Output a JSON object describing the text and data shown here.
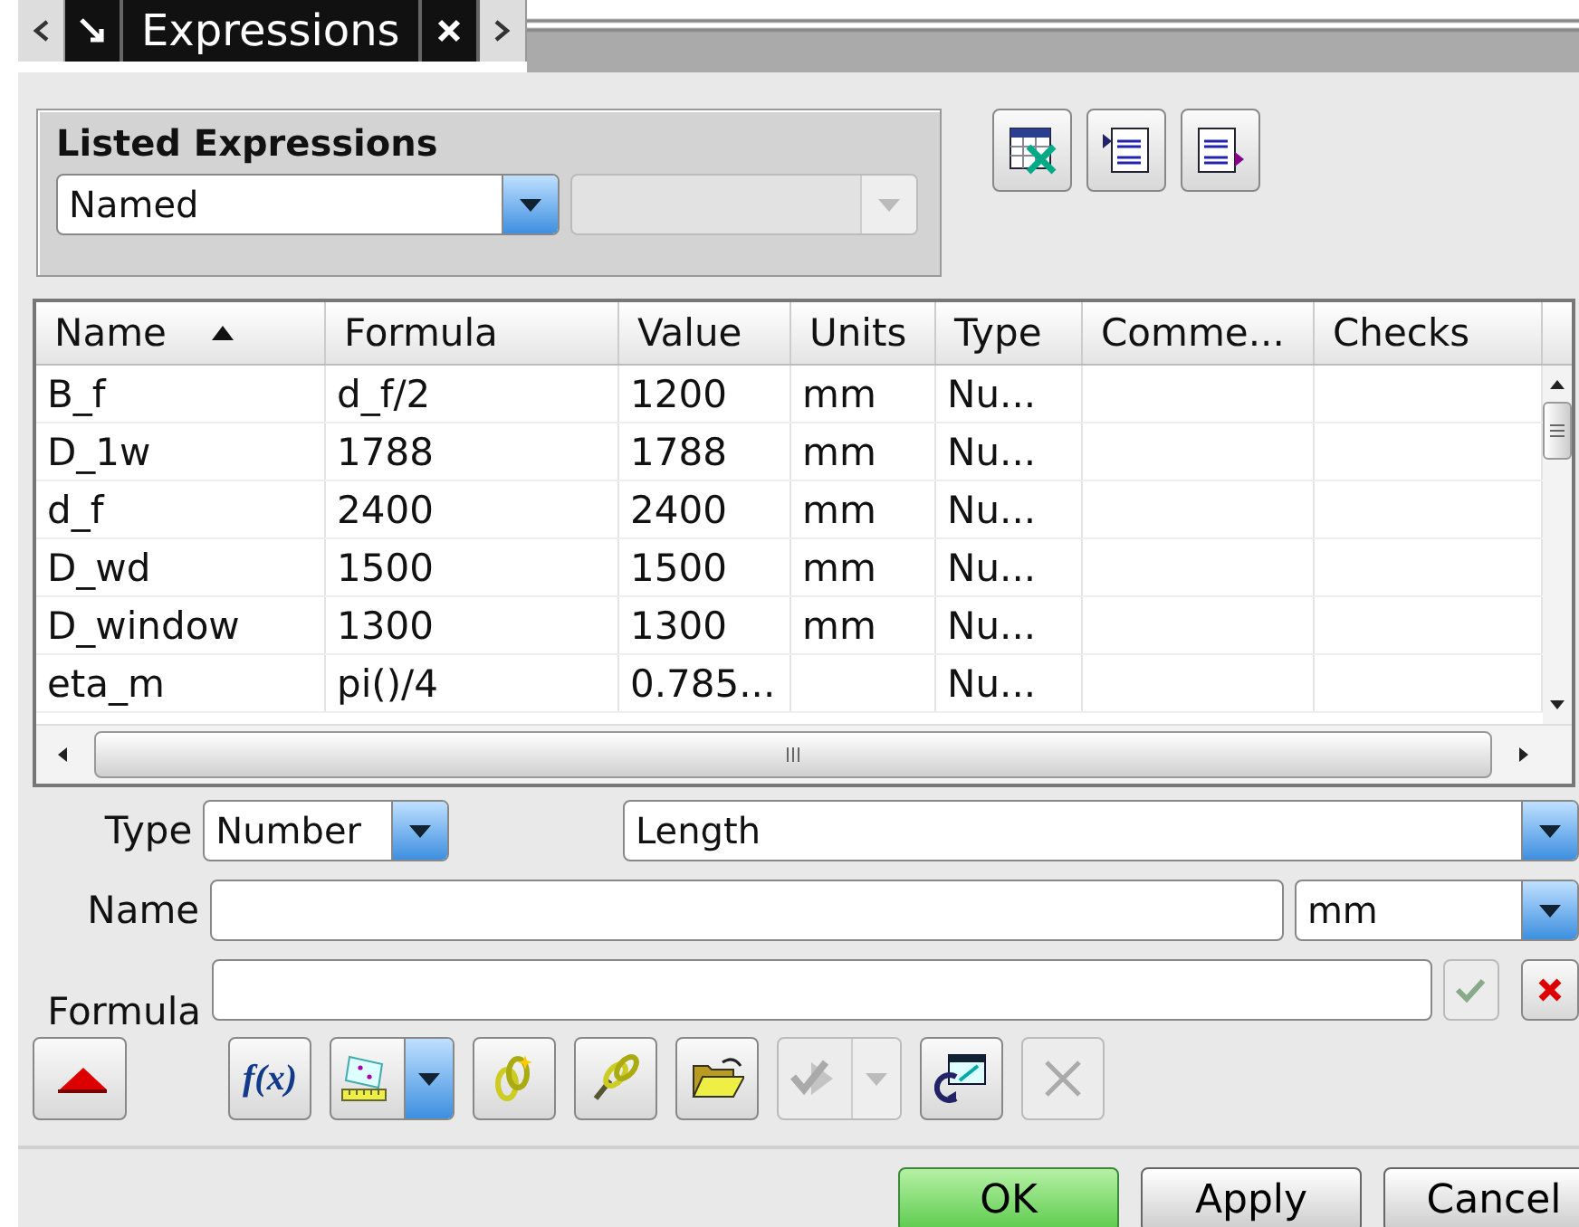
{
  "tab_strip": {
    "title": "Expressions"
  },
  "listed_expressions": {
    "title": "Listed Expressions",
    "filter": {
      "value": "Named",
      "disabled": false
    },
    "secondary_filter": {
      "disabled": true
    }
  },
  "top_tools": [
    {
      "kind": "spreadsheet"
    },
    {
      "kind": "import"
    },
    {
      "kind": "export"
    }
  ],
  "table": {
    "columns": [
      {
        "label": "Name",
        "sorted": true
      },
      {
        "label": "Formula",
        "sorted": false
      },
      {
        "label": "Value",
        "sorted": false
      },
      {
        "label": "Units",
        "sorted": false
      },
      {
        "label": "Type",
        "sorted": false
      },
      {
        "label": "Comme...",
        "sorted": false
      },
      {
        "label": "Checks",
        "sorted": false
      }
    ],
    "rows": [
      [
        "B_f",
        "d_f/2",
        "1200",
        "mm",
        "Nu..."
      ],
      [
        "D_1w",
        "1788",
        "1788",
        "mm",
        "Nu..."
      ],
      [
        "d_f",
        "2400",
        "2400",
        "mm",
        "Nu..."
      ],
      [
        "D_wd",
        "1500",
        "1500",
        "mm",
        "Nu..."
      ],
      [
        "D_window",
        "1300",
        "1300",
        "mm",
        "Nu..."
      ],
      [
        "eta_m",
        "pi()/4",
        "0.785...",
        "",
        "Nu..."
      ]
    ]
  },
  "form": {
    "type_label": "Type",
    "type_value": "Number",
    "dimension": "Length",
    "name_label": "Name",
    "units": "mm",
    "formula_label": "Formula",
    "accept_disabled": true
  },
  "tools": [
    {
      "kind": "collapse",
      "disabled": false
    },
    {
      "kind": "fx",
      "label": "f(x)",
      "disabled": false
    },
    {
      "kind": "measure",
      "disabled": false
    },
    {
      "kind": "create-link",
      "disabled": false
    },
    {
      "kind": "link",
      "disabled": false
    },
    {
      "kind": "open",
      "disabled": false
    },
    {
      "kind": "check-split",
      "disabled": true
    },
    {
      "kind": "refresh-window",
      "disabled": false
    },
    {
      "kind": "delete",
      "disabled": true
    }
  ],
  "buttons": [
    {
      "label": "OK",
      "default": true
    },
    {
      "label": "Apply",
      "default": false
    },
    {
      "label": "Cancel",
      "default": false
    }
  ]
}
